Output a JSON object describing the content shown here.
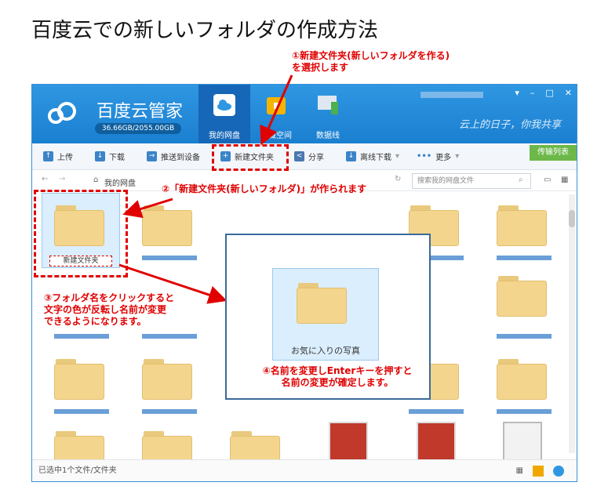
{
  "title": "百度云での新しいフォルダの作成方法",
  "app": {
    "brand": "百度云管家",
    "quota": "36.66GB/2055.00GB",
    "slogan": "云上的日子，你我共享",
    "nav": [
      {
        "label": "我的网盘",
        "icon": "cloud-icon"
      },
      {
        "label": "隐藏空间",
        "icon": "lock-icon"
      },
      {
        "label": "数据线",
        "icon": "devices-icon"
      }
    ],
    "toolbar": {
      "upload": "上传",
      "download": "下载",
      "push": "推送到设备",
      "new_folder": "新建文件夹",
      "share": "分享",
      "offline": "离线下载",
      "more": "更多",
      "transfer_list": "传输列表"
    },
    "path": {
      "home": "我的网盘",
      "search_placeholder": "搜索我的网盘文件"
    },
    "selected_folder_label": "新建文件夹",
    "status": "已选中1个文件/文件夹"
  },
  "annotations": {
    "step1": "①新建文件夹(新しいフォルダを作る)\nを選択します",
    "step2": "②「新建文件夹(新しいフォルダ)」が作られます",
    "step3": "③フォルダ名をクリックすると\n文字の色が反転し名前が変更\nできるようになります。",
    "step4": "④名前を変更しEnterキーを押すと\n名前の変更が確定します。"
  },
  "popup": {
    "folder_label": "お気に入りの写真"
  },
  "colors": {
    "topbar": "#2f97e2",
    "annotation": "#e00000",
    "folder": "#f4d58d"
  }
}
